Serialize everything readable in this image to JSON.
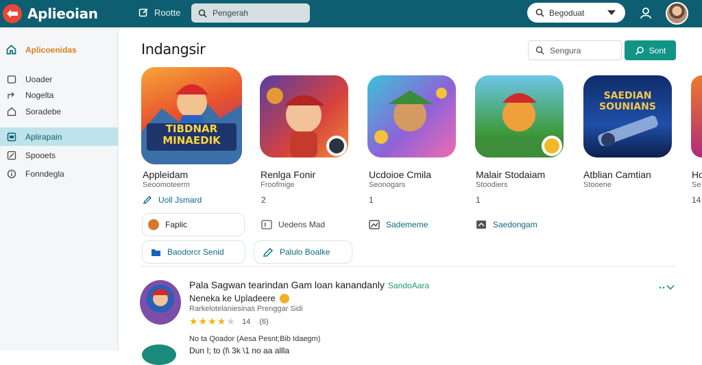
{
  "header": {
    "app_title": "Aplieoian",
    "link_label": "Rootte",
    "search_placeholder": "Pengerah",
    "select_value": "Begoduat",
    "colors": {
      "bar": "#0d5e70",
      "logo": "#e8473a"
    }
  },
  "sidebar": {
    "home_label": "Aplicoenidas",
    "items": [
      {
        "label": "Uoader",
        "icon": "square-icon"
      },
      {
        "label": "Nogelta",
        "icon": "share-icon"
      },
      {
        "label": "Soradebe",
        "icon": "home-icon"
      },
      {
        "label": "Aplirapain",
        "icon": "app-icon",
        "active": true
      },
      {
        "label": "Spooets",
        "icon": "edit-icon"
      },
      {
        "label": "Fonndegla",
        "icon": "info-icon"
      }
    ]
  },
  "main": {
    "title": "Indangsir",
    "search_placeholder": "Sengura",
    "button_label": "Sont",
    "accent": "#129484"
  },
  "apps": [
    {
      "name": "Appleidam",
      "sub": "Seoomoteerm",
      "extra": "Uoll Jsmard",
      "icon_text": "TIBDNAR MINAEDIK"
    },
    {
      "name": "Renlga Fonir",
      "sub": "Froofmige",
      "num": "2"
    },
    {
      "name": "Ucdoioe Cmila",
      "sub": "Seonogars",
      "num": "1"
    },
    {
      "name": "Malair Stodaiam",
      "sub": "Stoodiers",
      "num": "1"
    },
    {
      "name": "Atblian Camtian",
      "sub": "Stooene",
      "icon_text": "SAEDIAN SOUNIANS"
    },
    {
      "name": "Ho",
      "sub": "Se",
      "num": "14"
    }
  ],
  "actions": {
    "row1": [
      {
        "label": "Faplic",
        "icon": "ball-icon"
      },
      {
        "label": "Uedens Mad",
        "icon": "bars-icon"
      },
      {
        "label": "Sadememe",
        "icon": "image-icon"
      },
      {
        "label": "Saedongam",
        "icon": "tag-icon"
      }
    ],
    "row2": [
      {
        "label": "Baodorcr Senid",
        "icon": "folder-icon"
      },
      {
        "label": "Palulo Boalke",
        "icon": "pencil-icon"
      }
    ]
  },
  "review": {
    "title": "Pala Sagwan tearindan Gam loan kanandanly",
    "tag": "SandoAara",
    "line2": "Neneka ke Upladeere",
    "meta": "Rarkelotelaniesinas Prenggar Sidi",
    "rating": 4,
    "rating_max": 5,
    "rating_text": "14",
    "rating_count": "(6)",
    "extra": "No ta Qoador (Aesa Pesnt;Bib Idaegm)",
    "clipped": "Dun I; to (l\\ 3k \\1 no aa allla"
  }
}
